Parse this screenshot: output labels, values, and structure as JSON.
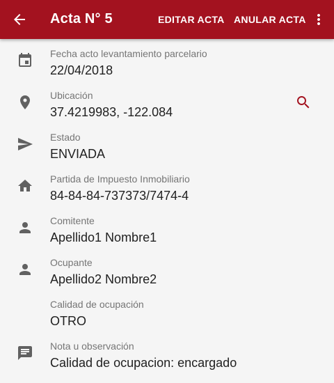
{
  "colors": {
    "app_bar": "#a3121f",
    "app_bar_text": "#ffffff",
    "icon": "#616161",
    "accent": "#a3121f",
    "label": "#757575",
    "value": "#212121",
    "background": "#f5f5f5"
  },
  "app_bar": {
    "back_icon": "arrow-back-icon",
    "title": "Acta N° 5",
    "actions": {
      "edit": "EDITAR ACTA",
      "cancel": "ANULAR ACTA"
    },
    "more_icon": "more-vert-icon"
  },
  "fields": [
    {
      "icon": "calendar-icon",
      "label": "Fecha acto levantamiento parcelario",
      "value": "22/04/2018"
    },
    {
      "icon": "location-pin-icon",
      "label": "Ubicación",
      "value": "37.4219983, -122.084",
      "action_icon": "search-icon"
    },
    {
      "icon": "send-icon",
      "label": "Estado",
      "value": "ENVIADA"
    },
    {
      "icon": "home-icon",
      "label": "Partida de Impuesto Inmobiliario",
      "value": "84-84-84-737373/7474-4"
    },
    {
      "icon": "person-icon",
      "label": "Comitente",
      "value": "Apellido1 Nombre1"
    },
    {
      "icon": "person-icon",
      "label": "Ocupante",
      "value": "Apellido2 Nombre2"
    },
    {
      "icon": "",
      "label": "Calidad de ocupación",
      "value": "OTRO"
    },
    {
      "icon": "comment-icon",
      "label": "Nota u observación",
      "value": "Calidad de ocupacion: encargado"
    }
  ]
}
